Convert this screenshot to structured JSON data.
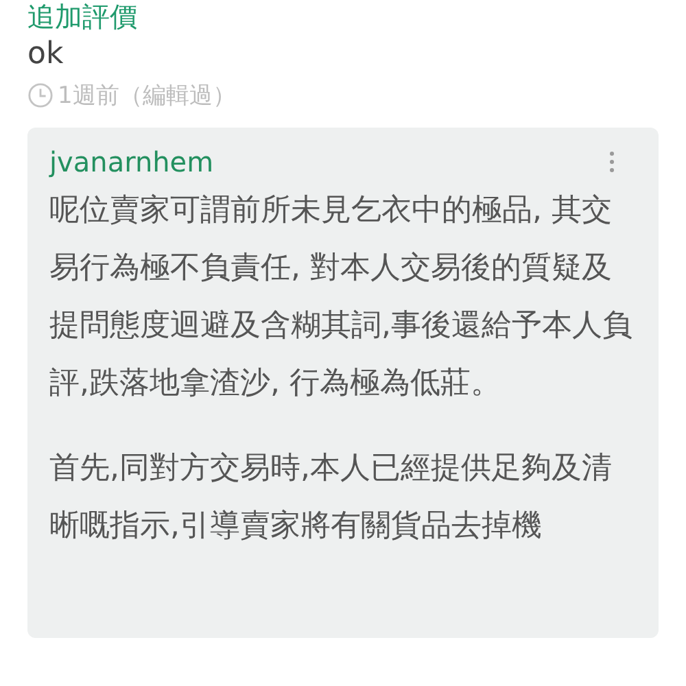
{
  "section_title": "追加評價",
  "comment": "ok",
  "timestamp": "1週前（編輯過）",
  "review": {
    "username": "jvanarnhem",
    "paragraphs": [
      "呢位賣家可謂前所未見乞衣中的極品, 其交易行為極不負責任, 對本人交易後的質疑及提問態度迴避及含糊其詞,事後還給予本人負評,跌落地拿渣沙, 行為極為低莊。",
      "首先,同對方交易時,本人已經提供足夠及清晰嘅指示,引導賣家將有關貨品去掉機"
    ]
  }
}
